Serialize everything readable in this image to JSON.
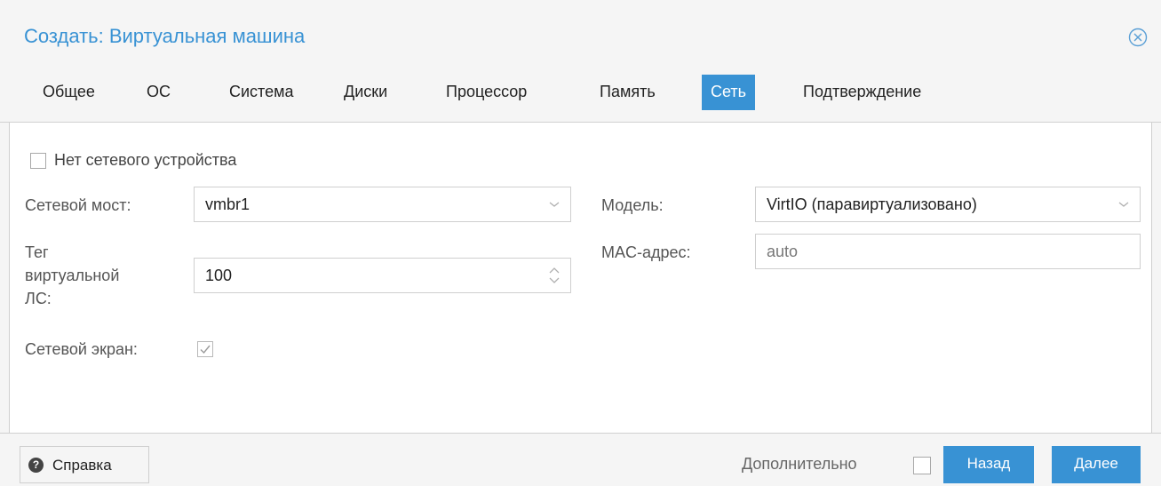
{
  "window": {
    "title": "Создать: Виртуальная машина"
  },
  "tabs": [
    {
      "label": "Общее"
    },
    {
      "label": "ОС"
    },
    {
      "label": "Система"
    },
    {
      "label": "Диски"
    },
    {
      "label": "Процессор"
    },
    {
      "label": "Память"
    },
    {
      "label": "Сеть",
      "active": true
    },
    {
      "label": "Подтверждение"
    }
  ],
  "form": {
    "no_network": {
      "label": "Нет сетевого устройства",
      "checked": false
    },
    "bridge": {
      "label": "Сетевой мост:",
      "value": "vmbr1"
    },
    "vlan": {
      "label_line1": "Тег",
      "label_line2": "виртуальной",
      "label_line3": "ЛС:",
      "value": "100"
    },
    "firewall": {
      "label": "Сетевой экран:",
      "checked": true
    },
    "model": {
      "label": "Модель:",
      "value": "VirtIO (паравиртуализовано)"
    },
    "mac": {
      "label": "MAC-адрес:",
      "placeholder": "auto"
    }
  },
  "footer": {
    "help_label": "Справка",
    "advanced_label": "Дополнительно",
    "advanced_checked": false,
    "back_label": "Назад",
    "next_label": "Далее"
  },
  "colors": {
    "accent": "#3892d4",
    "background": "#f5f5f5",
    "panel": "#ffffff",
    "border": "#d0d0d0"
  },
  "icons": {
    "close": "close-circle-icon",
    "dropdown": "chevron-down-icon",
    "spinner": "spinner-arrows-icon",
    "help": "question-circle-icon",
    "checkmark": "checkmark-icon"
  }
}
